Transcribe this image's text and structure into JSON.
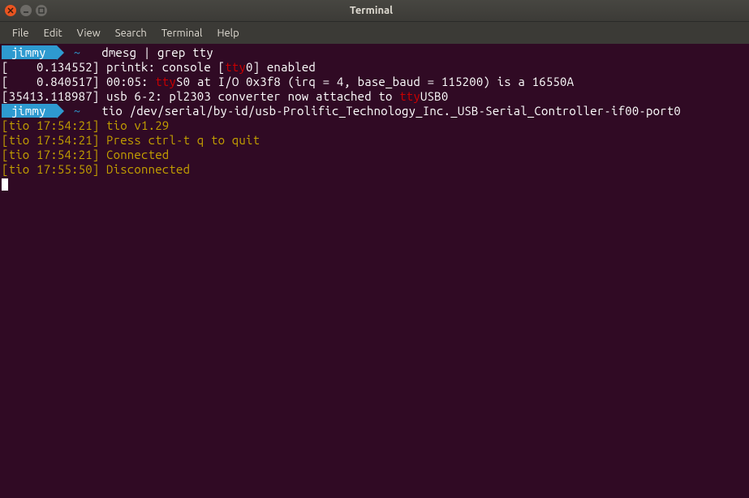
{
  "window": {
    "title": "Terminal"
  },
  "menubar": [
    "File",
    "Edit",
    "View",
    "Search",
    "Terminal",
    "Help"
  ],
  "prompt": {
    "user": "jimmy",
    "path": "~",
    "symbol": ""
  },
  "lines": [
    {
      "type": "prompt",
      "cmd": "dmesg | grep tty"
    },
    {
      "type": "output",
      "segments": [
        {
          "c": "white",
          "t": "[    0.134552] printk: console ["
        },
        {
          "c": "red",
          "t": "tty"
        },
        {
          "c": "white",
          "t": "0] enabled"
        }
      ]
    },
    {
      "type": "output",
      "segments": [
        {
          "c": "white",
          "t": "[    0.840517] 00:05: "
        },
        {
          "c": "red",
          "t": "tty"
        },
        {
          "c": "white",
          "t": "S0 at I/O 0x3f8 (irq = 4, base_baud = 115200) is a 16550A"
        }
      ]
    },
    {
      "type": "output",
      "segments": [
        {
          "c": "white",
          "t": "[35413.118987] usb 6-2: pl2303 converter now attached to "
        },
        {
          "c": "red",
          "t": "tty"
        },
        {
          "c": "white",
          "t": "USB0"
        }
      ]
    },
    {
      "type": "prompt",
      "cmd": "tio /dev/serial/by-id/usb-Prolific_Technology_Inc._USB-Serial_Controller-if00-port0"
    },
    {
      "type": "output",
      "segments": [
        {
          "c": "yellow",
          "t": "[tio 17:54:21] tio v1.29"
        }
      ]
    },
    {
      "type": "output",
      "segments": [
        {
          "c": "yellow",
          "t": "[tio 17:54:21] Press ctrl-t q to quit"
        }
      ]
    },
    {
      "type": "output",
      "segments": [
        {
          "c": "yellow",
          "t": "[tio 17:54:21] Connected"
        }
      ]
    },
    {
      "type": "output",
      "segments": [
        {
          "c": "yellow",
          "t": "[tio 17:55:50] Disconnected"
        }
      ]
    }
  ]
}
